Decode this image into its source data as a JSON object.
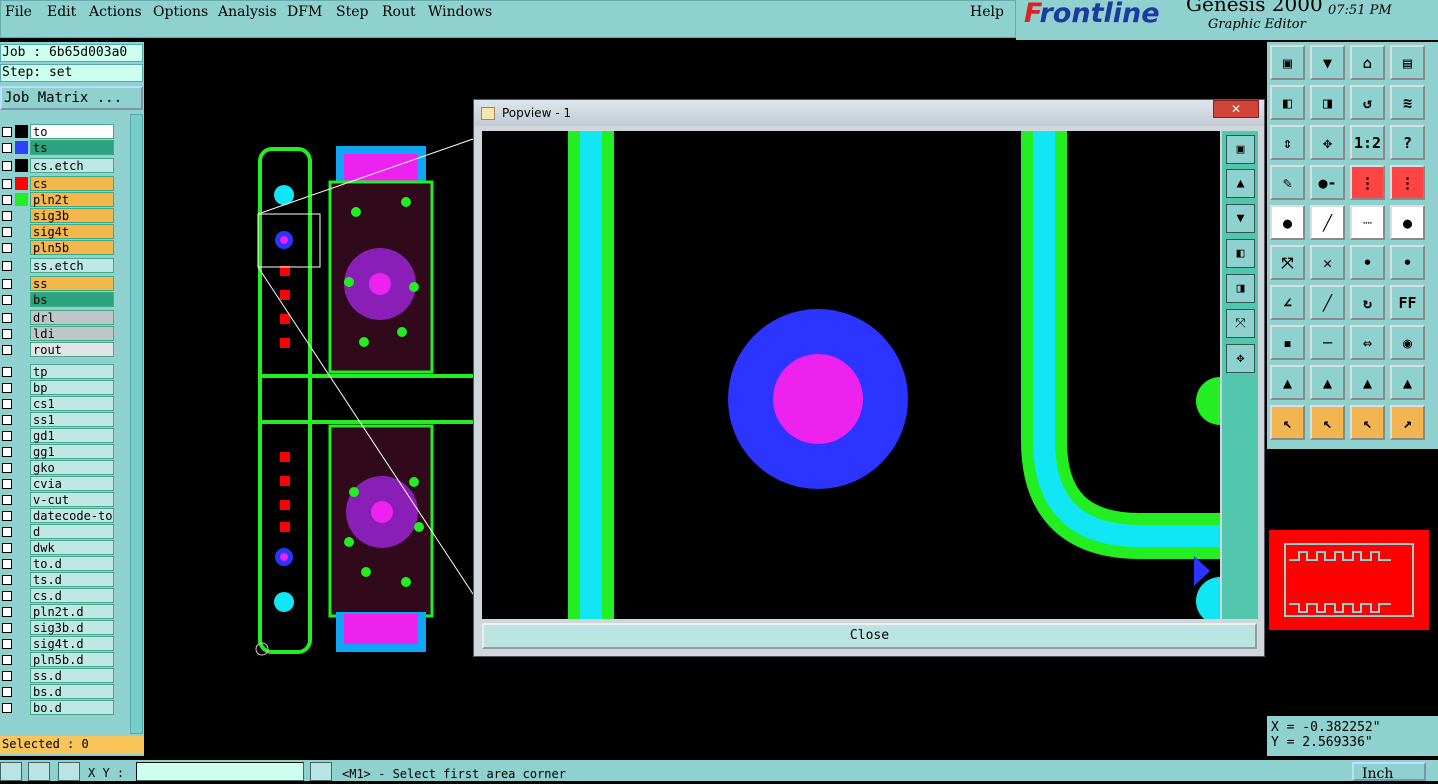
{
  "menu": [
    "File",
    "Edit",
    "Actions",
    "Options",
    "Analysis",
    "DFM",
    "Step",
    "Rout",
    "Windows"
  ],
  "help": "Help",
  "brand": {
    "logo_prefix": "F",
    "logo_rest": "rontline",
    "title": "Genesis 2000",
    "subtitle": "Graphic Editor",
    "time": "07:51 PM"
  },
  "job": {
    "name": "Job : 6b65d003a0",
    "step": "Step: set",
    "matrix_label": "Job Matrix ..."
  },
  "layers": [
    {
      "name": "to",
      "color": "#ffffff",
      "swatch": "#000000"
    },
    {
      "name": "ts",
      "color": "#2aa37e",
      "swatch": "#2b43ff"
    },
    {
      "name": "cs.etch",
      "color": "#bfe7e5",
      "swatch": "#000000"
    },
    {
      "name": "cs",
      "color": "#f4b74c",
      "swatch": "#ff0000"
    },
    {
      "name": "pln2t",
      "color": "#f4b74c",
      "swatch": "#22ee22"
    },
    {
      "name": "sig3b",
      "color": "#f4b74c",
      "swatch": ""
    },
    {
      "name": "sig4t",
      "color": "#f4b74c",
      "swatch": ""
    },
    {
      "name": "pln5b",
      "color": "#f4b74c",
      "swatch": ""
    },
    {
      "name": "ss.etch",
      "color": "#bfe7e5",
      "swatch": ""
    },
    {
      "name": "ss",
      "color": "#f4b74c",
      "swatch": ""
    },
    {
      "name": "bs",
      "color": "#2aa37e",
      "swatch": ""
    },
    {
      "name": "drl",
      "color": "#bfc6c8",
      "swatch": ""
    },
    {
      "name": "ldi",
      "color": "#bfc6c8",
      "swatch": ""
    },
    {
      "name": "rout",
      "color": "#e4e4e4",
      "swatch": ""
    },
    {
      "name": "tp",
      "color": "#bfe7e5",
      "swatch": ""
    },
    {
      "name": "bp",
      "color": "#bfe7e5",
      "swatch": ""
    },
    {
      "name": "cs1",
      "color": "#bfe7e5",
      "swatch": ""
    },
    {
      "name": "ss1",
      "color": "#bfe7e5",
      "swatch": ""
    },
    {
      "name": "gd1",
      "color": "#bfe7e5",
      "swatch": ""
    },
    {
      "name": "gg1",
      "color": "#bfe7e5",
      "swatch": ""
    },
    {
      "name": "gko",
      "color": "#bfe7e5",
      "swatch": ""
    },
    {
      "name": "cvia",
      "color": "#bfe7e5",
      "swatch": ""
    },
    {
      "name": "v-cut",
      "color": "#bfe7e5",
      "swatch": ""
    },
    {
      "name": "datecode-to",
      "color": "#bfe7e5",
      "swatch": ""
    },
    {
      "name": "d",
      "color": "#bfe7e5",
      "swatch": ""
    },
    {
      "name": "dwk",
      "color": "#bfe7e5",
      "swatch": ""
    },
    {
      "name": "to.d",
      "color": "#bfe7e5",
      "swatch": ""
    },
    {
      "name": "ts.d",
      "color": "#bfe7e5",
      "swatch": ""
    },
    {
      "name": "cs.d",
      "color": "#bfe7e5",
      "swatch": ""
    },
    {
      "name": "pln2t.d",
      "color": "#bfe7e5",
      "swatch": ""
    },
    {
      "name": "sig3b.d",
      "color": "#bfe7e5",
      "swatch": ""
    },
    {
      "name": "sig4t.d",
      "color": "#bfe7e5",
      "swatch": ""
    },
    {
      "name": "pln5b.d",
      "color": "#bfe7e5",
      "swatch": ""
    },
    {
      "name": "ss.d",
      "color": "#bfe7e5",
      "swatch": ""
    },
    {
      "name": "bs.d",
      "color": "#bfe7e5",
      "swatch": ""
    },
    {
      "name": "bo.d",
      "color": "#bfe7e5",
      "swatch": ""
    }
  ],
  "selected": "Selected : 0",
  "popview": {
    "title": "Popview - 1",
    "close_label": "Close",
    "close_x": "✕"
  },
  "coords": {
    "x": "X = -0.382252\"",
    "y": "Y = 2.569336\""
  },
  "status": {
    "xy_label": "X Y :",
    "message": "<M1> - Select first area corner",
    "units": "Inch"
  },
  "tools": [
    [
      "▣",
      "▼",
      "⌂",
      "▤"
    ],
    [
      "◧",
      "◨",
      "↺",
      "≋"
    ],
    [
      "⇕",
      "✥",
      "1:2",
      "?"
    ],
    [
      "✎",
      "●-",
      "⋮",
      "⋮"
    ],
    [
      "●",
      "╱",
      "┈",
      "●"
    ],
    [
      "⤧",
      "✕",
      "•",
      "•"
    ],
    [
      "∠",
      "╱",
      "↻",
      "FF"
    ],
    [
      "▪",
      "─",
      "⇔",
      "◉"
    ],
    [
      "▲",
      "▲",
      "▲",
      "▲"
    ],
    [
      "↖",
      "↖",
      "↖",
      "↗"
    ]
  ],
  "colors": {
    "green": "#22ee22",
    "cyan": "#11e6f5",
    "blue": "#2b35ff",
    "magenta": "#ee22ee",
    "panel": "#8fd1cf"
  }
}
